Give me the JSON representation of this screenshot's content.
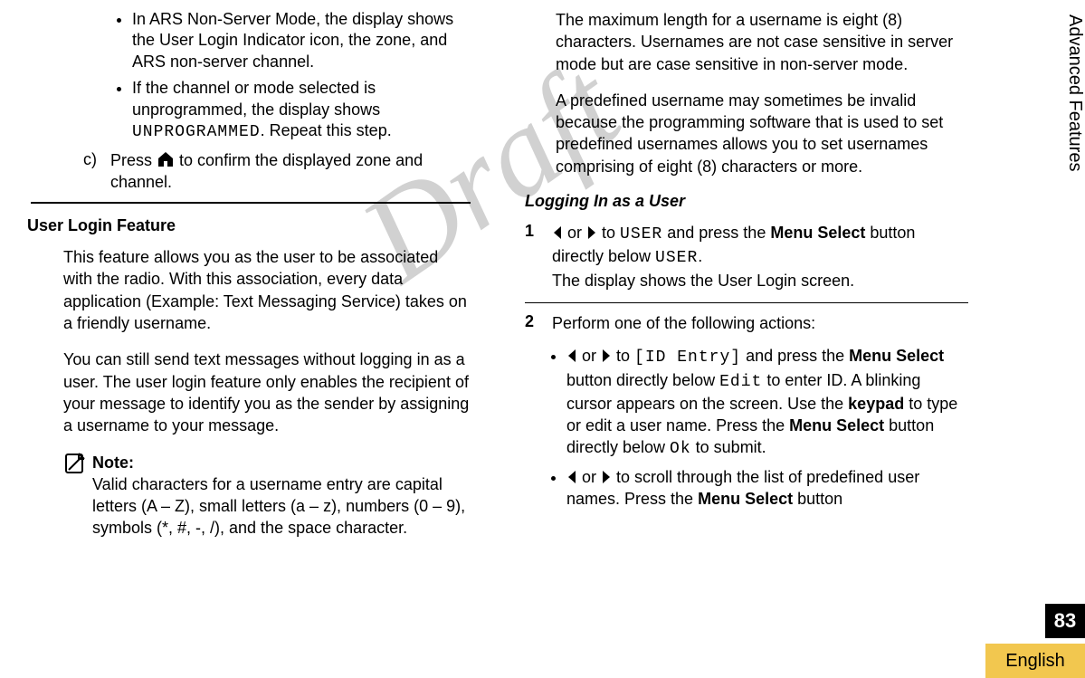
{
  "col1": {
    "bullet1": "In ARS Non-Server Mode, the display shows the User Login Indicator icon, the zone, and ARS non-server channel.",
    "bullet2_a": "If the channel or mode selected is unprogrammed, the display shows ",
    "bullet2_code": "UNPROGRAMMED",
    "bullet2_b": ". Repeat this step.",
    "step_c_label": "c)",
    "step_c_a": "Press ",
    "step_c_b": " to confirm the displayed zone and channel.",
    "section_head": "User Login Feature",
    "para1": "This feature allows you as the user to be associated with the radio. With this association, every data application (Example: Text Messaging Service) takes on a friendly username.",
    "para2": "You can still send text messages without logging in as a user. The user login feature only enables the recipient of your message to identify you as the sender by assigning a username to your message.",
    "note_title": "Note:",
    "note_body": "Valid characters for a username entry are capital letters (A – Z), small letters (a – z), numbers (0 – 9), symbols (*, #, -, /), and the space character."
  },
  "col2": {
    "para1": "The maximum length for a username is eight (8) characters. Usernames are not case sensitive in server mode but are case sensitive in non-server mode.",
    "para2": "A predefined username may sometimes be invalid because the programming software that is used to set predefined usernames allows you to set usernames comprising of eight (8) characters or more.",
    "section_head": "Logging In as a User",
    "step1_num": "1",
    "step1_or": " or ",
    "step1_to": " to ",
    "step1_code1": "USER",
    "step1_mid": " and press the ",
    "step1_bold1": "Menu Select",
    "step1_mid2": " button directly below ",
    "step1_code2": "USER",
    "step1_end": ".",
    "step1_line2": "The display shows the User Login screen.",
    "step2_num": "2",
    "step2_body": "Perform one of the following actions:",
    "sub1_or": " or ",
    "sub1_to": " to ",
    "sub1_code1": "[ID Entry]",
    "sub1_mid1": " and press the ",
    "sub1_bold1": "Menu Select",
    "sub1_mid2": " button directly below ",
    "sub1_code2": "Edit",
    "sub1_mid3": " to enter ID. A blinking cursor appears on the screen. Use the ",
    "sub1_bold2": "keypad",
    "sub1_mid4": " to type or edit a user name. Press the ",
    "sub1_bold3": "Menu Select",
    "sub1_mid5": " button directly below ",
    "sub1_code3": "Ok",
    "sub1_mid6": " to submit.",
    "sub2_or": " or ",
    "sub2_mid1": " to scroll through the list of predefined user names. Press the ",
    "sub2_bold1": "Menu Select",
    "sub2_mid2": " button"
  },
  "side": {
    "chapter": "Advanced Features",
    "page": "83",
    "lang": "English"
  },
  "watermark": "Draft"
}
